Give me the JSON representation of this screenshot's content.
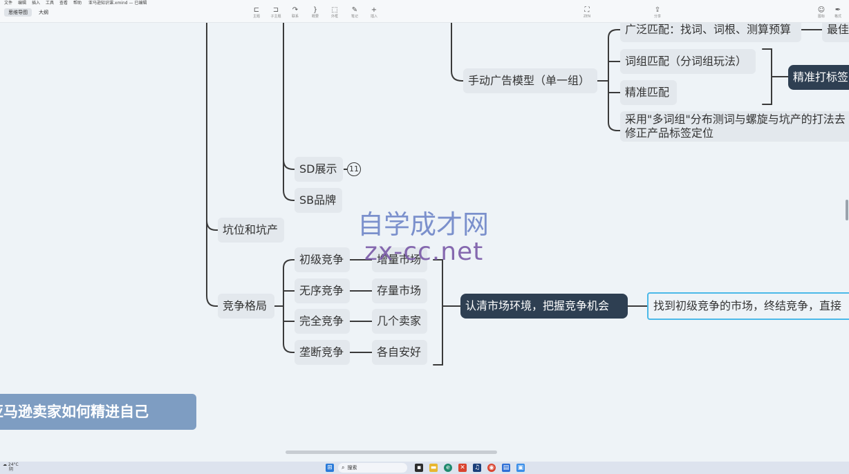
{
  "menu": {
    "items": [
      "文件",
      "编辑",
      "插入",
      "工具",
      "查看",
      "帮助"
    ],
    "doc_title": "亚马逊知识课.xmind — 已编辑"
  },
  "toolbar": {
    "view_tabs": [
      "思维导图",
      "大纲"
    ],
    "tools": [
      {
        "icon": "topic-icon",
        "glyph": "⊏",
        "label": "主题"
      },
      {
        "icon": "subtopic-icon",
        "glyph": "⊐",
        "label": "子主题"
      },
      {
        "icon": "relationship-icon",
        "glyph": "↷",
        "label": "联系"
      },
      {
        "icon": "summary-icon",
        "glyph": "}",
        "label": "概要"
      },
      {
        "icon": "boundary-icon",
        "glyph": "⬚",
        "label": "外框"
      },
      {
        "icon": "note-icon",
        "glyph": "✎",
        "label": "笔记"
      },
      {
        "icon": "insert-icon",
        "glyph": "+",
        "label": "插入"
      }
    ],
    "zen": {
      "icon": "zen-mode-icon",
      "glyph": "⛶",
      "label": "ZEN"
    },
    "share": {
      "icon": "share-icon",
      "glyph": "⇪",
      "label": "分享"
    },
    "right_tools": [
      {
        "icon": "icon-panel-icon",
        "glyph": "☺",
        "label": "图标"
      },
      {
        "icon": "format-panel-icon",
        "glyph": "✒",
        "label": "格式"
      }
    ]
  },
  "map": {
    "root": "亚马逊卖家如何精进自己",
    "kengwei": "坑位和坑产",
    "jingzheng": "竞争格局",
    "sd": "SD展示",
    "sd_badge": "11",
    "sb": "SB品牌",
    "manual": "手动广告模型（单一组）",
    "broad": "广泛匹配：找词、词根、测算预算",
    "broad_next": "最佳",
    "phrase": "词组匹配（分词组玩法）",
    "exact": "精准匹配",
    "exact_summary": "精准打标签",
    "multi": "采用\"多词组\"分布测词与螺旋与坑产的打法去修正产品标签定位",
    "competition": [
      {
        "type": "初级竞争",
        "market": "增量市场"
      },
      {
        "type": "无序竞争",
        "market": "存量市场"
      },
      {
        "type": "完全竞争",
        "market": "几个卖家"
      },
      {
        "type": "垄断竞争",
        "market": "各自安好"
      }
    ],
    "market_summary": "认清市场环境，把握竞争机会",
    "market_next": "找到初级竞争的市场，终结竞争，直接"
  },
  "watermark": {
    "cn": "自学成才网",
    "en": "zx-cc.net"
  },
  "taskbar": {
    "weather_temp": "24°C",
    "weather_desc": "阴",
    "search_placeholder": "搜索",
    "apps": [
      "start-icon",
      "files-icon",
      "folder-icon",
      "edge-icon",
      "app-icon",
      "music-icon",
      "chrome-icon",
      "notepad-icon",
      "xmind-icon"
    ]
  }
}
